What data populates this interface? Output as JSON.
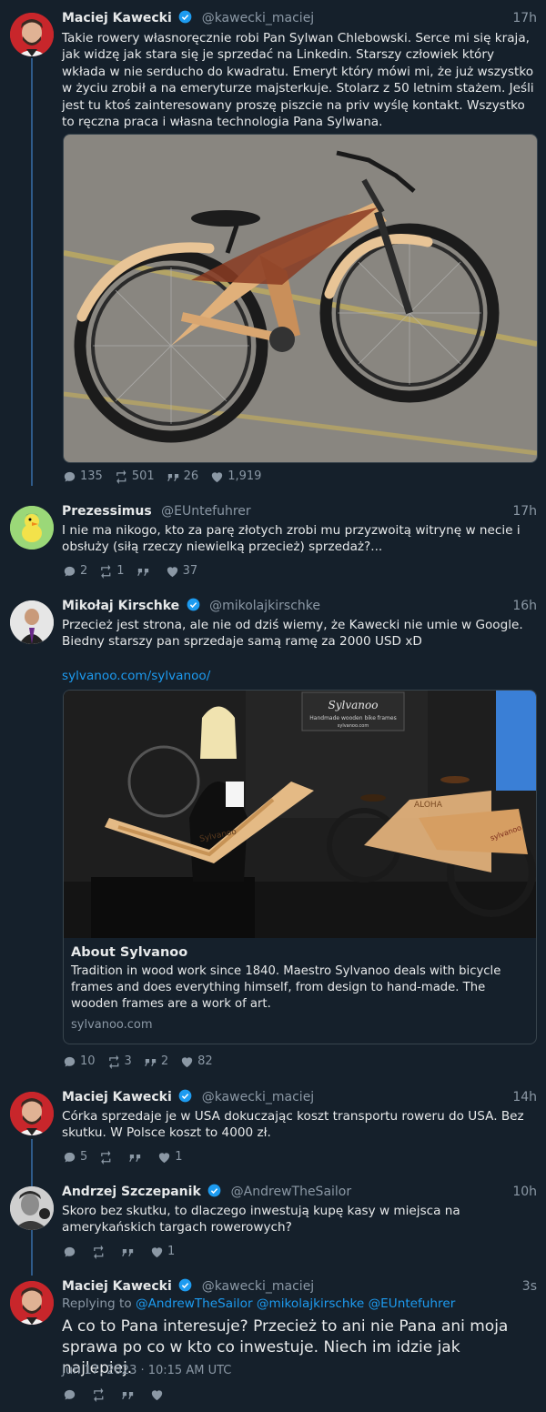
{
  "tweets": [
    {
      "name": "Maciej Kawecki",
      "handle": "@kawecki_maciej",
      "time": "17h",
      "text": "Takie rowery własnoręcznie robi Pan Sylwan Chlebowski. Serce mi się kraja, jak widzę jak stara się je sprzedać na Linkedin. Starszy człowiek który wkłada w nie serducho do kwadratu. Emeryt który mówi mi, że już wszystko w życiu zrobił a na emeryturze majsterkuje. Stolarz z 50 letnim stażem. Jeśli jest tu ktoś zainteresowany proszę piszcie na priv wyślę kontakt. Wszystko to ręczna praca i własna technologia Pana Sylwana.",
      "replies": "135",
      "retweets": "501",
      "quotes": "26",
      "likes": "1,919"
    },
    {
      "name": "Prezessimus",
      "handle": "@EUntefuhrer",
      "time": "17h",
      "text": "I nie ma nikogo, kto za parę złotych zrobi mu przyzwoitą witrynę w necie i obsłuży (siłą rzeczy niewielką przecież) sprzedaż?...",
      "replies": "2",
      "retweets": "1",
      "quotes": "",
      "likes": "37"
    },
    {
      "name": "Mikołaj Kirschke",
      "handle": "@mikolajkirschke",
      "time": "16h",
      "text": "Przecież jest strona, ale nie od dziś wiemy, że Kawecki nie umie w Google. Biedny starszy pan sprzedaje samą ramę za 2000 USD xD",
      "link": "sylvanoo.com/sylvanoo/",
      "card": {
        "title": "About Sylvanoo",
        "description": "Tradition in wood work since 1840. Maestro Sylvanoo deals with bicycle frames and does everything himself, from design to hand-made. The wooden frames are a work of art.",
        "domain": "sylvanoo.com",
        "banner_title": "Sylvanoo",
        "banner_sub": "Handmade wooden bike frames",
        "banner_url": "sylvanoo.com",
        "frame_text": "Sylvanoo",
        "bike_text": "sylvanoo",
        "aloha_text": "ALOHA"
      },
      "replies": "10",
      "retweets": "3",
      "quotes": "2",
      "likes": "82"
    },
    {
      "name": "Maciej Kawecki",
      "handle": "@kawecki_maciej",
      "time": "14h",
      "text": "Córka sprzedaje je w USA dokuczając koszt transportu roweru do USA. Bez skutku. W Polsce koszt to 4000 zł.",
      "replies": "5",
      "retweets": "",
      "quotes": "",
      "likes": "1"
    },
    {
      "name": "Andrzej Szczepanik",
      "handle": "@AndrewTheSailor",
      "time": "10h",
      "text": "Skoro bez skutku, to dlaczego inwestują kupę kasy w miejsca na amerykańskich targach rowerowych?",
      "replies": "",
      "retweets": "",
      "quotes": "",
      "likes": "1"
    },
    {
      "name": "Maciej Kawecki",
      "handle": "@kawecki_maciej",
      "time": "3s",
      "reply_prefix": "Replying to",
      "reply_mentions": "@AndrewTheSailor @mikolajkirschke @EUntefuhrer",
      "text": "A co to Pana interesuje? Przecież to ani nie Pana ani moja sprawa po co w kto co inwestuje. Niech im idzie jak najlepiej.",
      "date": "Jun 17, 2023 · 10:15 AM UTC",
      "replies": "",
      "retweets": "",
      "quotes": "",
      "likes": ""
    }
  ],
  "colors": {
    "background": "#15202b",
    "text": "#e7e9ea",
    "muted": "#8b98a5",
    "link": "#1d9bf0",
    "thread": "#2f5b8a",
    "border": "#38444d"
  },
  "icons": {
    "reply": "reply-icon",
    "retweet": "retweet-icon",
    "quote": "quote-icon",
    "like": "heart-icon",
    "verified": "verified-badge-icon"
  }
}
